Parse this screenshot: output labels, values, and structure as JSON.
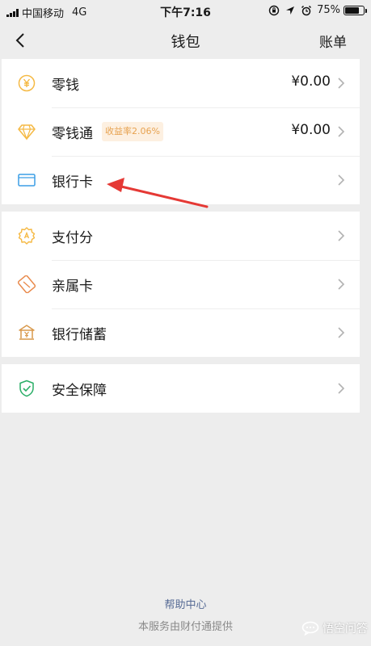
{
  "status_bar": {
    "carrier": "中国移动",
    "network": "4G",
    "time": "下午7:16",
    "battery": "75%",
    "battery_level": 0.75
  },
  "nav": {
    "title": "钱包",
    "right_label": "账单",
    "back_icon": "chevron-left-icon"
  },
  "section1": {
    "items": [
      {
        "label": "零钱",
        "value": "¥0.00",
        "icon": "yuan-coin-icon"
      },
      {
        "label": "零钱通",
        "badge": "收益率2.06%",
        "value": "¥0.00",
        "icon": "diamond-icon"
      },
      {
        "label": "银行卡",
        "icon": "card-icon"
      }
    ]
  },
  "section2": {
    "items": [
      {
        "label": "支付分",
        "icon": "score-badge-icon"
      },
      {
        "label": "亲属卡",
        "icon": "family-card-icon"
      },
      {
        "label": "银行储蓄",
        "icon": "bank-savings-icon"
      }
    ]
  },
  "section3": {
    "items": [
      {
        "label": "安全保障",
        "icon": "shield-check-icon"
      }
    ]
  },
  "footer": {
    "help_link": "帮助中心",
    "provider_note": "本服务由财付通提供"
  },
  "watermark": {
    "text": "悟空问答"
  },
  "colors": {
    "background": "#ededed",
    "card": "#ffffff",
    "icon_orange": "#f5b944",
    "icon_blue": "#3b9ee5",
    "icon_green": "#2aae67",
    "badge_bg": "#fdf0e1",
    "badge_text": "#e7a250",
    "link": "#576b95",
    "annotation_arrow": "#e53935"
  }
}
